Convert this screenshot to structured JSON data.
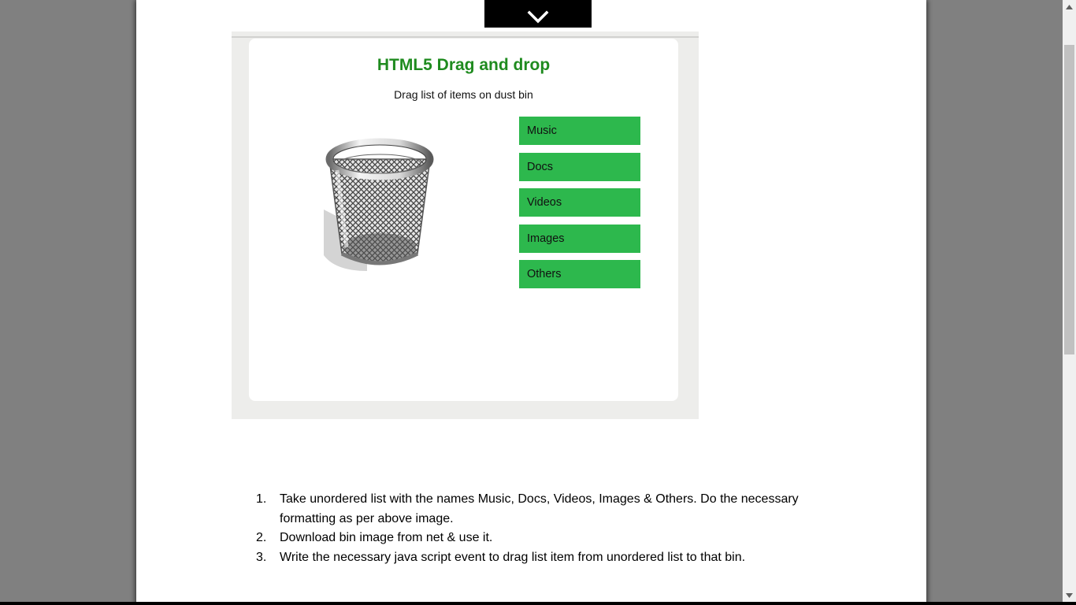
{
  "figure": {
    "title": "HTML5 Drag and drop",
    "subtitle": "Drag list of items on dust bin",
    "items": [
      "Music",
      "Docs",
      "Videos",
      "Images",
      "Others"
    ],
    "title_color": "#1f8b1f",
    "item_color": "#2db84d"
  },
  "instructions": [
    {
      "num": "1.",
      "text": "Take unordered list with the names Music, Docs, Videos, Images & Others.  Do the necessary formatting as per above image."
    },
    {
      "num": "2.",
      "text": "Download bin image from net & use it."
    },
    {
      "num": "3.",
      "text": "Write the necessary java script event to drag list item from unordered list to that bin."
    }
  ],
  "icons": {
    "collapse": "chevron-down-icon",
    "bin": "trash-bin-icon",
    "scroll_up": "scroll-up-arrow-icon",
    "scroll_down": "scroll-down-arrow-icon"
  }
}
